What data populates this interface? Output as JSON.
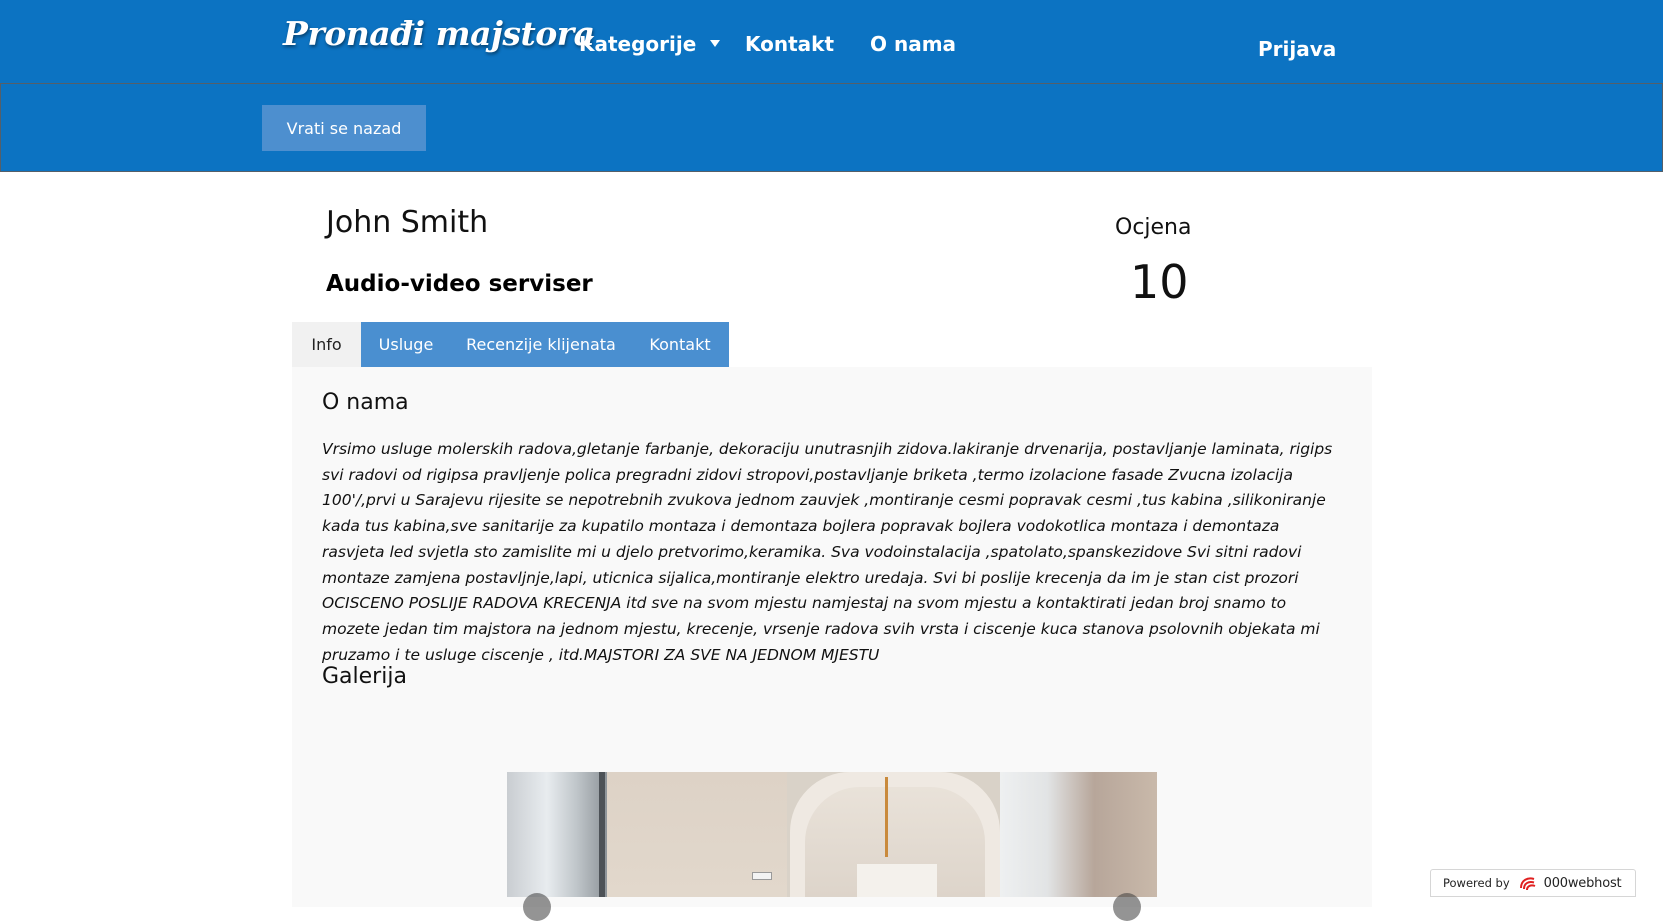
{
  "header": {
    "logo": "Pronađi majstora",
    "nav": {
      "categories": "Kategorije",
      "contact": "Kontakt",
      "about": "O nama",
      "login": "Prijava"
    }
  },
  "subbar": {
    "back_button": "Vrati se nazad"
  },
  "profile": {
    "name": "John Smith",
    "profession": "Audio-video serviser",
    "rating_label": "Ocjena",
    "rating_value": "10"
  },
  "tabs": [
    {
      "label": "Info",
      "active": true
    },
    {
      "label": "Usluge",
      "active": false
    },
    {
      "label": "Recenzije klijenata",
      "active": false
    },
    {
      "label": "Kontakt",
      "active": false
    }
  ],
  "content": {
    "about_title": "O nama",
    "about_text": "Vrsimo usluge molerskih radova,gletanje farbanje, dekoraciju unutrasnjih zidova.lakiranje drvenarija, postavljanje laminata, rigips svi radovi od rigipsa pravljenje polica pregradni zidovi stropovi,postavljanje briketa ,termo izolacione fasade Zvucna izolacija 100'/,prvi u Sarajevu rijesite se nepotrebnih zvukova jednom zauvjek ,montiranje cesmi popravak cesmi ,tus kabina ,silikoniranje kada tus kabina,sve sanitarije za kupatilo montaza i demontaza bojlera popravak bojlera vodokotlica montaza i demontaza rasvjeta led svjetla sto zamislite mi u djelo pretvorimo,keramika. Sva vodoinstalacija ,spatolato,spanskezidove Svi sitni radovi montaze zamjena postavljnje,lapi, uticnica sijalica,montiranje elektro uredaja. Svi bi poslije krecenja da im je stan cist prozori OCISCENO POSLIJE RADOVA KRECENJA itd sve na svom mjestu namjestaj na svom mjestu a kontaktirati jedan broj snamo to mozete jedan tim majstora na jednom mjestu, krecenje, vrsenje radova svih vrsta i ciscenje kuca stanova psolovnih objekata mi pruzamo i te usluge ciscenje , itd.MAJSTORI ZA SVE NA JEDNOM MJESTU",
    "gallery_title": "Galerija"
  },
  "footer_badge": {
    "label": "Powered by",
    "brand": "000webhost",
    "icon": "webhost-logo-icon"
  },
  "colors": {
    "navbar": "#0c73c2",
    "button": "#4d8fcf",
    "tab": "#4a8fd0",
    "tab_active": "#f1f1f1"
  }
}
